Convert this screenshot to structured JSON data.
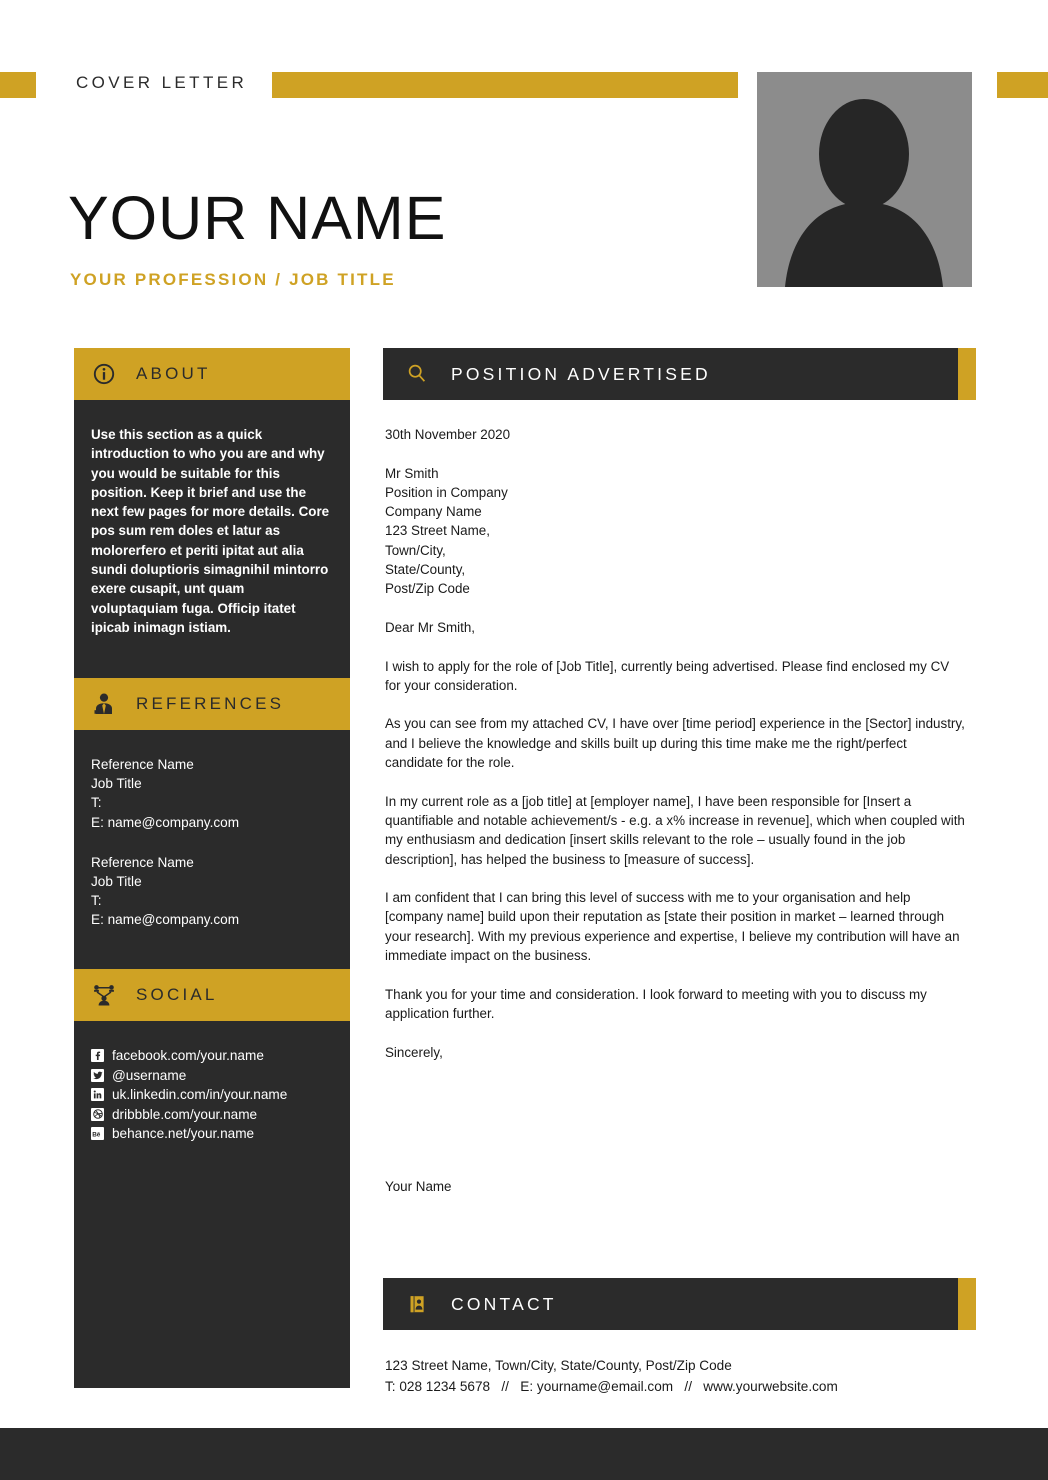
{
  "document": {
    "type": "cover-letter-template",
    "header_label": "COVER LETTER",
    "name": "YOUR NAME",
    "profession": "YOUR PROFESSION / JOB TITLE"
  },
  "colors": {
    "accent_gold": "#cfa224",
    "dark": "#2b2b2b",
    "photo_placeholder": "#8c8c8c",
    "body_text": "#1a1a1a"
  },
  "photo": {
    "icon": "person-silhouette-icon",
    "alt": "photo placeholder"
  },
  "sidebar": {
    "about": {
      "icon": "info-icon",
      "title": "ABOUT",
      "body": "Use this section as a quick introduction to who you are and why you would be suitable for this position. Keep it brief and use the next few pages for more details. Core pos sum rem doles et latur as molorerfero et periti ipitat aut alia sundi doluptioris simagnihil mintorro exere cusapit, unt quam voluptaquiam fuga. Officip itatet ipicab inimagn istiam."
    },
    "references": {
      "icon": "person-tie-icon",
      "title": "REFERENCES",
      "items": [
        {
          "name": "Reference Name",
          "job_title": "Job Title",
          "phone": "T:",
          "email": "E: name@company.com"
        },
        {
          "name": "Reference Name",
          "job_title": "Job Title",
          "phone": "T:",
          "email": "E: name@company.com"
        }
      ]
    },
    "social": {
      "icon": "network-share-icon",
      "title": "SOCIAL",
      "items": [
        {
          "icon": "facebook-icon",
          "glyph": "f",
          "label": "facebook.com/your.name"
        },
        {
          "icon": "twitter-icon",
          "glyph": "✈",
          "label": "@username"
        },
        {
          "icon": "linkedin-icon",
          "glyph": "in",
          "label": "uk.linkedin.com/in/your.name"
        },
        {
          "icon": "dribbble-icon",
          "glyph": "◎",
          "label": "dribbble.com/your.name"
        },
        {
          "icon": "behance-icon",
          "glyph": "Bē",
          "label": "behance.net/your.name"
        }
      ]
    }
  },
  "main": {
    "position_section": {
      "icon": "magnifier-icon",
      "title": "POSITION ADVERTISED"
    },
    "letter": {
      "date": "30th November 2020",
      "recipient_address": [
        "Mr Smith",
        "Position in Company",
        "Company Name",
        "123 Street Name,",
        "Town/City,",
        "State/County,",
        "Post/Zip Code"
      ],
      "salutation": "Dear Mr Smith,",
      "paragraphs": [
        "I wish to apply for the role of [Job Title], currently being advertised.  Please find enclosed my CV for your consideration.",
        "As you can see from my attached CV, I have over [time period] experience in the [Sector] industry, and I believe the knowledge and skills built up during this time make me the right/perfect candidate for the role.",
        "In my current role as a [job title] at [employer name], I have been responsible for [Insert a quantifiable and notable achievement/s - e.g. a x% increase in revenue], which when coupled with my enthusiasm and dedication [insert skills relevant to the role – usually found in the job description], has helped the business to [measure of success].",
        "I am confident that I can bring this level of success with me to your organisation and help [company name] build upon their reputation as [state their position in market – learned through your research]. With my previous experience and expertise, I believe my contribution will have an immediate impact on the business.",
        "Thank you for your time and consideration. I look forward to meeting with you to discuss my application further."
      ],
      "closing": "Sincerely,",
      "signature_name": "Your Name"
    },
    "contact_section": {
      "icon": "contact-card-icon",
      "title": "CONTACT",
      "address": "123 Street Name, Town/City, State/County, Post/Zip Code",
      "details": "T: 028 1234 5678   //   E: yourname@email.com   //   www.yourwebsite.com"
    }
  }
}
